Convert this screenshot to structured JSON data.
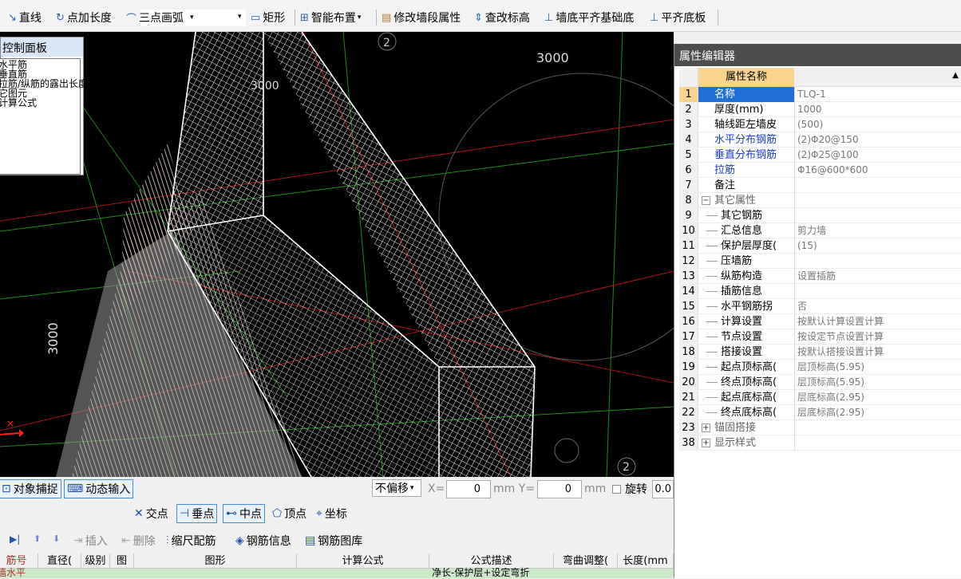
{
  "toolbar": {
    "items": [
      {
        "label": "直线",
        "icon": "line-icon"
      },
      {
        "label": "点加长度",
        "icon": "point-length-icon"
      },
      {
        "label": "三点画弧",
        "icon": "arc-icon"
      },
      {
        "label": "矩形",
        "icon": "rectangle-icon"
      },
      {
        "label": "智能布置",
        "icon": "smart-layout-icon"
      },
      {
        "label": "修改墙段属性",
        "icon": "modify-wall-icon"
      },
      {
        "label": "查改标高",
        "icon": "elevation-icon"
      },
      {
        "label": "墙底平齐基础底",
        "icon": "wall-align-icon"
      },
      {
        "label": "平齐底板",
        "icon": "align-slab-icon"
      }
    ]
  },
  "control_panel": {
    "title": "控制面板",
    "items": [
      "水平筋",
      "垂直筋",
      "拉筋/纵筋的露出长度",
      "它图元",
      "计算公式"
    ]
  },
  "viewport": {
    "labels": {
      "dim_top": "3000",
      "dim_left": "3000",
      "dim_top2": "3000",
      "axis_a": "2",
      "axis_b": "2"
    }
  },
  "property_editor": {
    "title": "属性编辑器",
    "header": "属性名称",
    "rows": [
      {
        "num": "1",
        "name": "名称",
        "value": "TLQ-1",
        "style": "sel"
      },
      {
        "num": "2",
        "name": "厚度(mm)",
        "value": "1000",
        "style": ""
      },
      {
        "num": "3",
        "name": "轴线距左墙皮",
        "value": "(500)",
        "style": ""
      },
      {
        "num": "4",
        "name": "水平分布钢筋",
        "value": "(2)Φ20@150",
        "style": "blue"
      },
      {
        "num": "5",
        "name": "垂直分布钢筋",
        "value": "(2)Φ25@100",
        "style": "blue"
      },
      {
        "num": "6",
        "name": "拉筋",
        "value": "Φ16@600*600",
        "style": "blue"
      },
      {
        "num": "7",
        "name": "备注",
        "value": "",
        "style": ""
      },
      {
        "num": "8",
        "name": "其它属性",
        "value": "",
        "style": "group"
      },
      {
        "num": "9",
        "name": "其它钢筋",
        "value": "",
        "style": "tree"
      },
      {
        "num": "10",
        "name": "汇总信息",
        "value": "剪力墙",
        "style": "tree"
      },
      {
        "num": "11",
        "name": "保护层厚度(",
        "value": "(15)",
        "style": "tree"
      },
      {
        "num": "12",
        "name": "压墙筋",
        "value": "",
        "style": "tree"
      },
      {
        "num": "13",
        "name": "纵筋构造",
        "value": "设置插筋",
        "style": "tree"
      },
      {
        "num": "14",
        "name": "插筋信息",
        "value": "",
        "style": "tree"
      },
      {
        "num": "15",
        "name": "水平钢筋拐",
        "value": "否",
        "style": "tree"
      },
      {
        "num": "16",
        "name": "计算设置",
        "value": "按默认计算设置计算",
        "style": "tree"
      },
      {
        "num": "17",
        "name": "节点设置",
        "value": "按设定节点设置计算",
        "style": "tree"
      },
      {
        "num": "18",
        "name": "搭接设置",
        "value": "按默认搭接设置计算",
        "style": "tree"
      },
      {
        "num": "19",
        "name": "起点顶标高(",
        "value": "层顶标高(5.95)",
        "style": "tree"
      },
      {
        "num": "20",
        "name": "终点顶标高(",
        "value": "层顶标高(5.95)",
        "style": "tree"
      },
      {
        "num": "21",
        "name": "起点底标高(",
        "value": "层底标高(2.95)",
        "style": "tree"
      },
      {
        "num": "22",
        "name": "终点底标高(",
        "value": "层底标高(2.95)",
        "style": "tree"
      },
      {
        "num": "23",
        "name": "锚固搭接",
        "value": "",
        "style": "group"
      },
      {
        "num": "38",
        "name": "显示样式",
        "value": "",
        "style": "group"
      }
    ]
  },
  "statusbar": {
    "snap": "对象捕捉",
    "dynamic": "动态输入",
    "offset_select": "不偏移",
    "x_label": "X=",
    "x_value": "0",
    "y_label": "mm Y=",
    "y_value": "0",
    "mm": "mm",
    "rotate": "旋转",
    "rotate_value": "0.0"
  },
  "snapbar": {
    "items": [
      {
        "label": "交点",
        "icon": "intersection-icon"
      },
      {
        "label": "垂点",
        "icon": "perpendicular-icon"
      },
      {
        "label": "中点",
        "icon": "midpoint-icon"
      },
      {
        "label": "顶点",
        "icon": "vertex-icon"
      },
      {
        "label": "坐标",
        "icon": "coordinate-icon"
      }
    ]
  },
  "rebarbar": {
    "items": [
      {
        "label": "插入",
        "icon": "insert-icon"
      },
      {
        "label": "删除",
        "icon": "delete-icon"
      },
      {
        "label": "缩尺配筋",
        "icon": "scale-rebar-icon"
      },
      {
        "label": "钢筋信息",
        "icon": "rebar-info-icon"
      },
      {
        "label": "钢筋图库",
        "icon": "rebar-library-icon"
      }
    ]
  },
  "grid": {
    "columns": [
      "筋号",
      "直径(",
      "级别",
      "图",
      "图形",
      "计算公式",
      "公式描述",
      "弯曲调整(",
      "长度(mm"
    ],
    "row1": {
      "name": "墙水平",
      "desc": "净长-保护层+设定弯折"
    }
  }
}
